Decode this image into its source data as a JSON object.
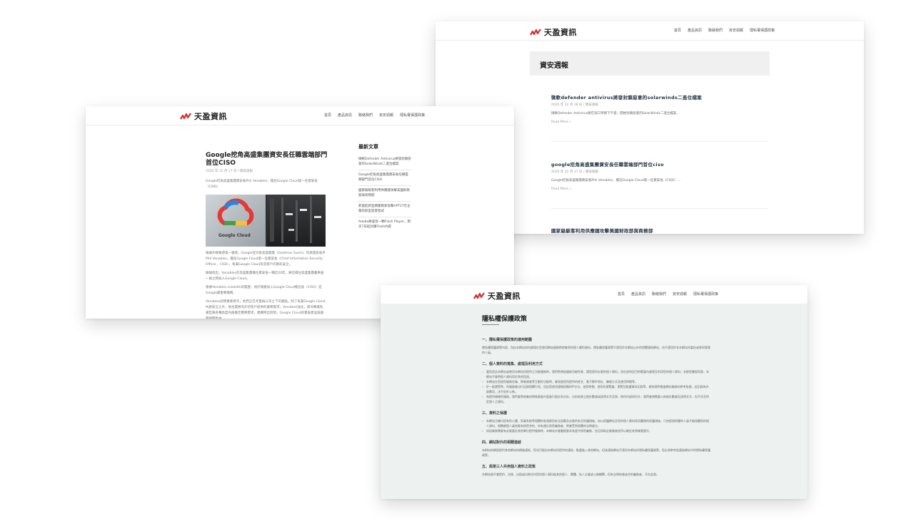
{
  "brand": {
    "name": "天盈資訊",
    "colors": {
      "accent": "#d32f2f",
      "logo_dark": "#222222"
    }
  },
  "winB": {
    "nav": [
      "首頁",
      "產品資訊",
      "聯絡我們",
      "資安週報",
      "隱私權保護政策"
    ],
    "page_title": "資安週報",
    "posts": [
      {
        "title": "微軟defender antivirus將發封鎖惡意的solarwinds二進位檔案",
        "meta": "2020 年 12 月 18 日 / 資安週報",
        "excerpt": "微軟Defender Antivirus將在週三時間下午發，開始封鎖惡意的SolarWinds二進位檔案…",
        "more": "Read More »"
      },
      {
        "title": "google挖角高盛集團資安長任職雲端部門首位ciso",
        "meta": "2020 年 12 月 17 日 / 資安週報",
        "excerpt": "Google挖角高盛集團資安長Phil Venables，擔任Google Cloud第一任資安長（CISO）…",
        "more": "Read More »"
      },
      {
        "title": "國家級駭客利用供應鏈攻擊美國財政部與商務部"
      }
    ]
  },
  "winA": {
    "nav": [
      "首頁",
      "產品資訊",
      "聯絡我們",
      "資安週報",
      "隱私權保護政策"
    ],
    "article_title": "Google挖角高盛集團資安長任職雲端部門首位CISO",
    "article_meta": "2020 年 12 月 17 日 / 資安週報",
    "article_intro": "Google挖角高盛集團資安長Phil Venables，擔任Google Cloud第一任資安長（CISO）",
    "hero_label": "Google Cloud",
    "body": [
      "根據外媒報導第一報導，Google近日從高盛集團（Goldman Sachs）挖來資安長手Phil Venables，擔任Google Cloud第一任資安長（Chief Information Security Officer，CISO），負責Google Cloud及其客戶的資訊安全。",
      "據報指出，Venables在高盛集團擔任資安長一職近20年，將在擔任高盛集團董事會一員之際加入Google Cloud。",
      "根據Venables LinkedIn的履歷，他於隨著加入Google Cloud擔任長（CISO）是Google最重要職務。",
      "Venables說明重要者示，他們正在考量與公司之下的重點，除了負責Google Cloud內部安全之外，他也還將為外的客戶提供的業務需求；Venables強化，資深專業負責監看各種高度內部最佳實務需求，建構特出到現，Google Cloud的資安產品與服務相關集中…"
    ],
    "sidebar_title": "最新文章",
    "sidebar_items": [
      "微軟Defender Antivirus將發封鎖惡意的SolarWinds二進位檔案",
      "Google挖角高盛集團資安長任職雲端部門首位CISO",
      "國家級駭客利用供應鏈攻擊美國財政部與商務部",
      "新竄起新型網路勒索攻擊APT27在企業的新型惡意程式",
      "Adobe將會從一顆Flash Player，明天7日起封鎖Flash內容"
    ]
  },
  "winC": {
    "nav": [
      "首頁",
      "產品資訊",
      "聯絡我們",
      "資安週報",
      "隱私權保護政策"
    ],
    "policy_title": "隱私權保護政策",
    "sections": [
      {
        "heading": "一、隱私權保護政策的適用範圍",
        "paras": [
          "隱私權保護政策內容，包括本網站如何處理在您使用網站服務時收集到的個人識別資料。隱私權保護政策不適用於本網站以外的相關連結網站，也不適用於非本網站所委託或參與管理的人員。"
        ],
        "bullets": []
      },
      {
        "heading": "二、個人資料的蒐集、處理及利用方式",
        "paras": [],
        "bullets": [
          "當您造訪本網站或使用本網站所提供之功能服務時，我們將視該服務功能性質，請您提供必要的個人資料，並在該特定目的範圍內處理及利用您的個人資料；非經您書面同意，本網站不會將個人資料用於其他用途。",
          "本網站在您使用服務信箱、問卷調查等互動性功能時，會保留您所提供的姓名、電子郵件地址、聯絡方式及使用時間等。",
          "於一般瀏覽時，伺服器會自行記錄相關行徑，包括您使用連線設備的IP位址、使用時間、使用的瀏覽器、瀏覽及點選資料記錄等，做為我們增進網站服務的參考依據，此記錄為內部應用，決不對外公佈。",
          "為提供精確的服務，我們會將收集的問卷調查內容進行統計與分析，分析結果之統計數據或說明文字呈現，除供內部研究外，我們會視需要公佈統計數據及說明文字，但不涉及特定個人之資料。"
        ]
      },
      {
        "heading": "三、資料之保護",
        "paras": [],
        "bullets": [
          "本網站主機均設有防火牆、防毒系統等相關的各項資訊安全設備及必要的安全防護措施，加以保護網站及您的個人資料採用嚴格的保護措施，只由經過授權的人員才能接觸您的個人資料，相關處理人員皆簽有保密合約，如有違反保密義務者，將會受到相關的法律處分。",
          "如因業務需要有必要委託其他單位提供服務時，本網站亦會嚴格要求其遵守保密義務，並且採取必要檢查程序以確定其將確實遵守。"
        ]
      },
      {
        "heading": "四、網站對外的相關連結",
        "paras": [
          "本網站的網頁提供其他網站的網路連結，您也可經由本網站所提供的連結，點選進入其他網站。但該連結網站不適用本網站的隱私權保護政策，您必須參考該連結網站中的隱私權保護政策。"
        ],
        "bullets": []
      },
      {
        "heading": "五、與第三人共用個人資料之政策",
        "paras": [
          "本網站絕不會提供、交換、出租或出售任何您的個人資料給其他個人、團體、私人企業或公務機關，但有法律依據或合約義務者，不在此限。"
        ],
        "bullets": []
      }
    ]
  }
}
